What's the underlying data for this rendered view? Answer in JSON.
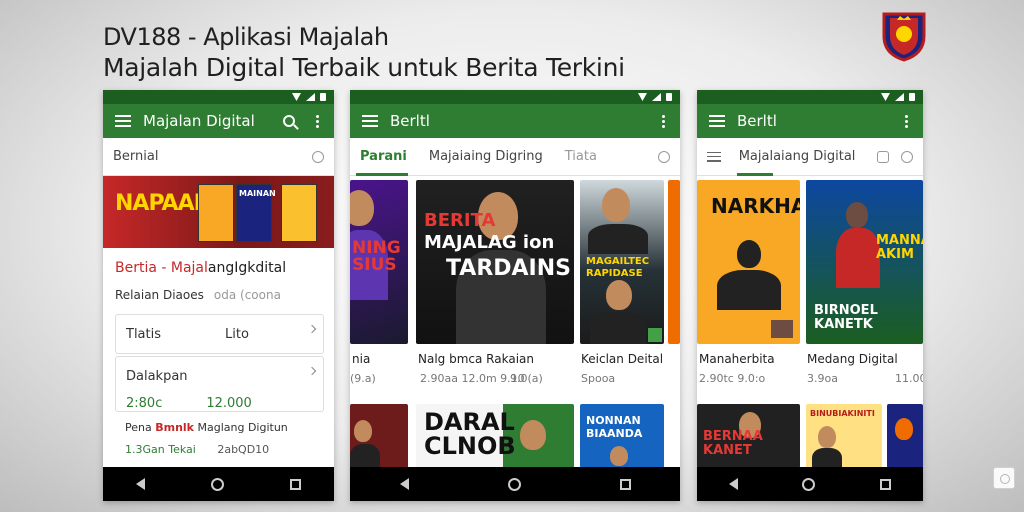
{
  "headline": {
    "line1": "DV188 - Aplikasi Majalah",
    "line2": "Majalah Digital Terbaik untuk Berita Terkini"
  },
  "phone1": {
    "appbar_title": "Majalan Digital",
    "tab_label": "Bernial",
    "banner_text": "NAPAAN",
    "banner_book_text": "MAINAN",
    "heading_red": "Bertia - Majal",
    "heading_dark": "angIgkdital",
    "subtitle": "Relaian Diaoes",
    "subtitle_muted": "oda (coona",
    "row1_left": "Tlatis",
    "row1_right": "Lito",
    "row2_left": "Dalakpan",
    "row3_left": "2:80c",
    "row3_right": "12.000",
    "footer_prefix": "Pena",
    "footer_red": "Bmnlk",
    "footer_suffix": "Maglang Digitun",
    "footer2_left": "1.3Gan Tekai",
    "footer2_right": "2abQD10"
  },
  "phone2": {
    "appbar_title": "Berltl",
    "tabs": [
      "Parani",
      "Majaiaing Digring",
      "Tiata"
    ],
    "tile_main_line1": "BERITA",
    "tile_main_line2": "MAJALAG ion",
    "tile_main_line3": "TARDAINS",
    "tile_right_text": "MAGAILTEC\nRAPIDASE",
    "tile_left_text": "NING\nSIUS",
    "caption_left": "nia",
    "caption_left_sub": "(9.a)",
    "caption_main": "Nalg bmca Rakaian",
    "caption_main_sub": "2.90aa 12.0m 9.10",
    "caption_main_sub2": "9.0(a)",
    "caption_right": "Keiclan Deital",
    "caption_right_sub": "Spooa",
    "tile_b1_text": "DARAL\nCLNOB",
    "tile_b2_text": "NONNAN\nBIAANDA"
  },
  "phone3": {
    "appbar_title": "Berltl",
    "tab_label": "Majalaiang Digital",
    "tile_left_text": "NARKHAI",
    "tile_right_text": "MANNA\nAKIM",
    "tile_right_bottom": "BIRNOEL\nKANETK",
    "caption_left": "Manaherbita",
    "caption_left_sub": "2.90tc 9.0:o",
    "caption_right": "Medang Digital",
    "caption_right_sub": "3.9oa",
    "caption_right_sub2": "11.00",
    "tile_b1_text": "BERNAA\nKANET",
    "tile_b2_text": "BINUBIAKINITI"
  },
  "colors": {
    "primary": "#2e7d32",
    "primary_dark": "#1b5e20",
    "accent_red": "#c62828",
    "accent_yellow": "#ffd600"
  }
}
